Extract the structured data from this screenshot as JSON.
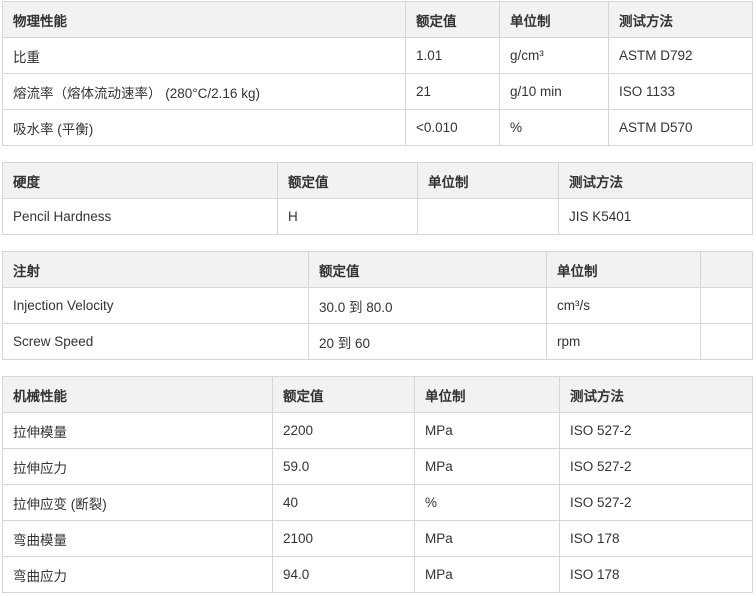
{
  "tables": [
    {
      "headers": [
        "物理性能",
        "额定值",
        "单位制",
        "测试方法"
      ],
      "rows": [
        [
          "比重",
          "1.01",
          "g/cm³",
          "ASTM D792"
        ],
        [
          "熔流率（熔体流动速率） (280°C/2.16 kg)",
          "21",
          "g/10 min",
          "ISO 1133"
        ],
        [
          "吸水率 (平衡)",
          "<0.010",
          "%",
          "ASTM D570"
        ]
      ]
    },
    {
      "headers": [
        "硬度",
        "额定值",
        "单位制",
        "测试方法"
      ],
      "rows": [
        [
          "Pencil Hardness",
          "H",
          "",
          "JIS K5401"
        ]
      ]
    },
    {
      "headers": [
        "注射",
        "额定值",
        "单位制",
        ""
      ],
      "rows": [
        [
          "Injection Velocity",
          "30.0 到 80.0",
          "cm³/s",
          ""
        ],
        [
          "Screw Speed",
          "20 到 60",
          "rpm",
          ""
        ]
      ]
    },
    {
      "headers": [
        "机械性能",
        "额定值",
        "单位制",
        "测试方法"
      ],
      "rows": [
        [
          "拉伸模量",
          "2200",
          "MPa",
          "ISO 527-2"
        ],
        [
          "拉伸应力",
          "59.0",
          "MPa",
          "ISO 527-2"
        ],
        [
          "拉伸应变 (断裂)",
          "40",
          "%",
          "ISO 527-2"
        ],
        [
          "弯曲模量",
          "2100",
          "MPa",
          "ISO 178"
        ],
        [
          "弯曲应力",
          "94.0",
          "MPa",
          "ISO 178"
        ]
      ]
    }
  ]
}
